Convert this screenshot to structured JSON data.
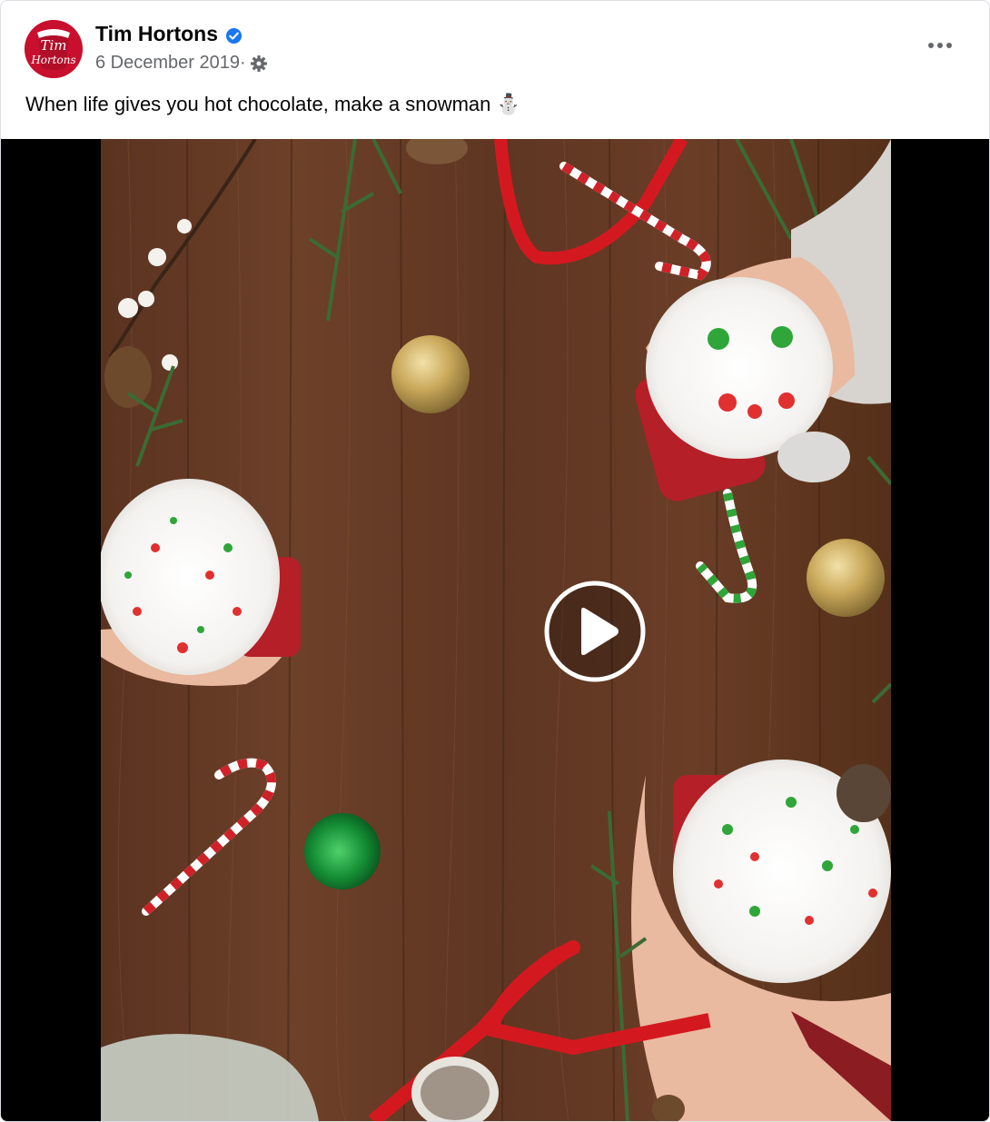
{
  "post": {
    "page_name": "Tim Hortons",
    "date": "6 December 2019",
    "date_separator": "·",
    "caption": "When life gives you hot chocolate, make a snowman",
    "caption_emoji": "⛄",
    "avatar_text_line1": "Tim",
    "avatar_text_line2": "Hortons"
  },
  "icons": {
    "verified": "verified-badge-icon",
    "privacy": "gear-icon",
    "more": "more-options-icon",
    "play": "play-icon"
  },
  "colors": {
    "brand_red": "#c8102e",
    "verified_blue": "#1877f2",
    "secondary_text": "#65676b",
    "primary_text": "#050505"
  }
}
